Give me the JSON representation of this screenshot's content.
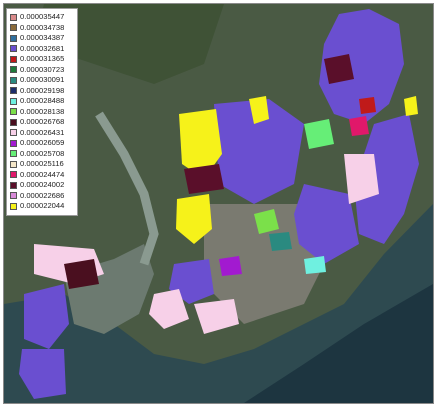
{
  "legend": {
    "items": [
      {
        "label": "0.000035447",
        "color": "#d98a8a"
      },
      {
        "label": "0.000034738",
        "color": "#8a6a3a"
      },
      {
        "label": "0.000034387",
        "color": "#2f6f9f"
      },
      {
        "label": "0.000032681",
        "color": "#6a4fd0"
      },
      {
        "label": "0.000031365",
        "color": "#c01a1a"
      },
      {
        "label": "0.000030723",
        "color": "#1f7a3a"
      },
      {
        "label": "0.000030091",
        "color": "#2a8a80"
      },
      {
        "label": "0.000029198",
        "color": "#1c2d6a"
      },
      {
        "label": "0.000028488",
        "color": "#6ff0e0"
      },
      {
        "label": "0.000028138",
        "color": "#7be04a"
      },
      {
        "label": "0.000026768",
        "color": "#4a0f1f"
      },
      {
        "label": "0.000026431",
        "color": "#f7d0e8"
      },
      {
        "label": "0.000026059",
        "color": "#a21ad0"
      },
      {
        "label": "0.000025708",
        "color": "#66ee77"
      },
      {
        "label": "0.000025116",
        "color": "#f4e6c8"
      },
      {
        "label": "0.000024474",
        "color": "#e0186a"
      },
      {
        "label": "0.000024002",
        "color": "#5a0f2a"
      },
      {
        "label": "0.000022686",
        "color": "#d88ad8"
      },
      {
        "label": "0.000022044",
        "color": "#f6f21a"
      }
    ]
  }
}
